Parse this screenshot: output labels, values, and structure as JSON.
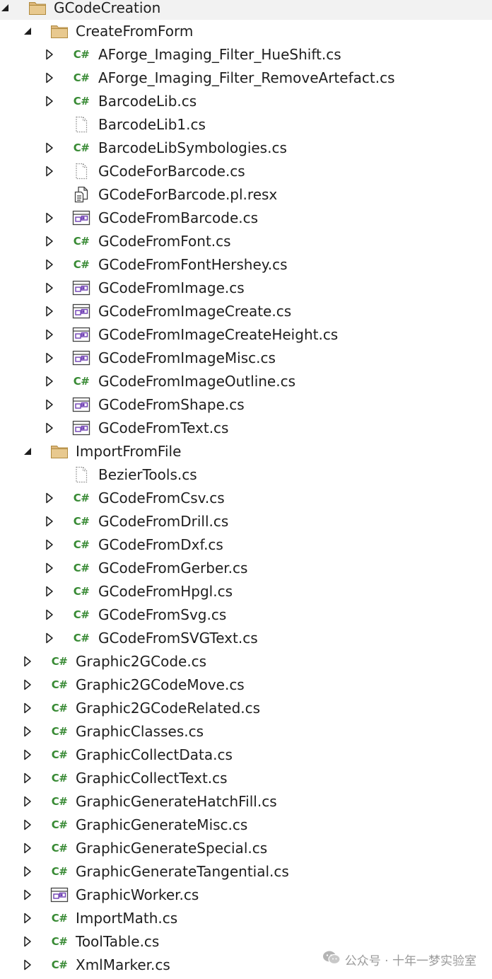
{
  "tree": [
    {
      "label": "GCodeCreation",
      "indent": 0,
      "expander": "expanded",
      "icon": "folder-icon"
    },
    {
      "label": "CreateFromForm",
      "indent": 1,
      "expander": "expanded",
      "icon": "folder-icon"
    },
    {
      "label": "AForge_Imaging_Filter_HueShift.cs",
      "indent": 2,
      "expander": "collapsed",
      "icon": "csharp-file-icon"
    },
    {
      "label": "AForge_Imaging_Filter_RemoveArtefact.cs",
      "indent": 2,
      "expander": "collapsed",
      "icon": "csharp-file-icon"
    },
    {
      "label": "BarcodeLib.cs",
      "indent": 2,
      "expander": "collapsed",
      "icon": "csharp-file-icon"
    },
    {
      "label": "BarcodeLib1.cs",
      "indent": 2,
      "expander": "none",
      "icon": "excluded-file-icon"
    },
    {
      "label": "BarcodeLibSymbologies.cs",
      "indent": 2,
      "expander": "collapsed",
      "icon": "csharp-file-icon"
    },
    {
      "label": "GCodeForBarcode.cs",
      "indent": 2,
      "expander": "collapsed",
      "icon": "excluded-file-icon"
    },
    {
      "label": "GCodeForBarcode.pl.resx",
      "indent": 2,
      "expander": "none",
      "icon": "resx-file-icon"
    },
    {
      "label": "GCodeFromBarcode.cs",
      "indent": 2,
      "expander": "collapsed",
      "icon": "form-file-icon"
    },
    {
      "label": "GCodeFromFont.cs",
      "indent": 2,
      "expander": "collapsed",
      "icon": "csharp-file-icon"
    },
    {
      "label": "GCodeFromFontHershey.cs",
      "indent": 2,
      "expander": "collapsed",
      "icon": "csharp-file-icon"
    },
    {
      "label": "GCodeFromImage.cs",
      "indent": 2,
      "expander": "collapsed",
      "icon": "form-file-icon"
    },
    {
      "label": "GCodeFromImageCreate.cs",
      "indent": 2,
      "expander": "collapsed",
      "icon": "form-file-icon"
    },
    {
      "label": "GCodeFromImageCreateHeight.cs",
      "indent": 2,
      "expander": "collapsed",
      "icon": "form-file-icon"
    },
    {
      "label": "GCodeFromImageMisc.cs",
      "indent": 2,
      "expander": "collapsed",
      "icon": "form-file-icon"
    },
    {
      "label": "GCodeFromImageOutline.cs",
      "indent": 2,
      "expander": "collapsed",
      "icon": "csharp-file-icon"
    },
    {
      "label": "GCodeFromShape.cs",
      "indent": 2,
      "expander": "collapsed",
      "icon": "form-file-icon"
    },
    {
      "label": "GCodeFromText.cs",
      "indent": 2,
      "expander": "collapsed",
      "icon": "form-file-icon"
    },
    {
      "label": "ImportFromFile",
      "indent": 1,
      "expander": "expanded",
      "icon": "folder-icon"
    },
    {
      "label": "BezierTools.cs",
      "indent": 2,
      "expander": "none",
      "icon": "excluded-file-icon"
    },
    {
      "label": "GCodeFromCsv.cs",
      "indent": 2,
      "expander": "collapsed",
      "icon": "csharp-file-icon"
    },
    {
      "label": "GCodeFromDrill.cs",
      "indent": 2,
      "expander": "collapsed",
      "icon": "csharp-file-icon"
    },
    {
      "label": "GCodeFromDxf.cs",
      "indent": 2,
      "expander": "collapsed",
      "icon": "csharp-file-icon"
    },
    {
      "label": "GCodeFromGerber.cs",
      "indent": 2,
      "expander": "collapsed",
      "icon": "csharp-file-icon"
    },
    {
      "label": "GCodeFromHpgl.cs",
      "indent": 2,
      "expander": "collapsed",
      "icon": "csharp-file-icon"
    },
    {
      "label": "GCodeFromSvg.cs",
      "indent": 2,
      "expander": "collapsed",
      "icon": "csharp-file-icon"
    },
    {
      "label": "GCodeFromSVGText.cs",
      "indent": 2,
      "expander": "collapsed",
      "icon": "csharp-file-icon"
    },
    {
      "label": "Graphic2GCode.cs",
      "indent": 1,
      "expander": "collapsed",
      "icon": "csharp-file-icon"
    },
    {
      "label": "Graphic2GCodeMove.cs",
      "indent": 1,
      "expander": "collapsed",
      "icon": "csharp-file-icon"
    },
    {
      "label": "Graphic2GCodeRelated.cs",
      "indent": 1,
      "expander": "collapsed",
      "icon": "csharp-file-icon"
    },
    {
      "label": "GraphicClasses.cs",
      "indent": 1,
      "expander": "collapsed",
      "icon": "csharp-file-icon"
    },
    {
      "label": "GraphicCollectData.cs",
      "indent": 1,
      "expander": "collapsed",
      "icon": "csharp-file-icon"
    },
    {
      "label": "GraphicCollectText.cs",
      "indent": 1,
      "expander": "collapsed",
      "icon": "csharp-file-icon"
    },
    {
      "label": "GraphicGenerateHatchFill.cs",
      "indent": 1,
      "expander": "collapsed",
      "icon": "csharp-file-icon"
    },
    {
      "label": "GraphicGenerateMisc.cs",
      "indent": 1,
      "expander": "collapsed",
      "icon": "csharp-file-icon"
    },
    {
      "label": "GraphicGenerateSpecial.cs",
      "indent": 1,
      "expander": "collapsed",
      "icon": "csharp-file-icon"
    },
    {
      "label": "GraphicGenerateTangential.cs",
      "indent": 1,
      "expander": "collapsed",
      "icon": "csharp-file-icon"
    },
    {
      "label": "GraphicWorker.cs",
      "indent": 1,
      "expander": "collapsed",
      "icon": "form-file-icon"
    },
    {
      "label": "ImportMath.cs",
      "indent": 1,
      "expander": "collapsed",
      "icon": "csharp-file-icon"
    },
    {
      "label": "ToolTable.cs",
      "indent": 1,
      "expander": "collapsed",
      "icon": "csharp-file-icon"
    },
    {
      "label": "XmlMarker.cs",
      "indent": 1,
      "expander": "collapsed",
      "icon": "csharp-file-icon"
    }
  ],
  "csharp_icon_text": "C#",
  "watermark": {
    "text": "公众号 · 十年一梦实验室",
    "icon": "wechat-icon"
  },
  "colors": {
    "folder_fill": "#dcb67a",
    "folder_stroke": "#b08a3e",
    "csharp_green": "#388a34",
    "form_purple": "#6f3fb4",
    "expander": "#1e1e1e",
    "text": "#1e1e1e",
    "excluded_stroke": "#8a8a8a",
    "watermark": "#9a9a9a"
  }
}
